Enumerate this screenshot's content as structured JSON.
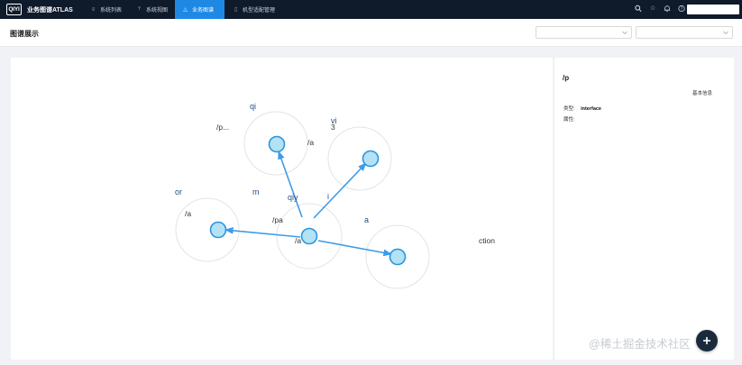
{
  "app": {
    "logo_text": "QIYI",
    "title": "业务图谱ATLAS"
  },
  "nav": [
    {
      "label": "系统列表",
      "icon": "list-icon",
      "active": false
    },
    {
      "label": "系统视图",
      "icon": "share-icon",
      "active": false
    },
    {
      "label": "业务图谱",
      "icon": "graph-icon",
      "active": true
    },
    {
      "label": "机型适配管理",
      "icon": "mobile-icon",
      "active": false
    }
  ],
  "topbar_icons": [
    "search-icon",
    "star-icon",
    "bell-icon",
    "help-icon"
  ],
  "page": {
    "title": "图谱展示"
  },
  "graph": {
    "labels": [
      {
        "text": "qi",
        "dark": false
      },
      {
        "text": "/p...",
        "dark": true
      },
      {
        "text": "3",
        "dark": true
      },
      {
        "text": "vi",
        "dark": false
      },
      {
        "text": "/a",
        "dark": true
      },
      {
        "text": "or",
        "dark": false
      },
      {
        "text": "m",
        "dark": false
      },
      {
        "text": "/a",
        "dark": true
      },
      {
        "text": "qiy",
        "dark": false
      },
      {
        "text": "i",
        "dark": false
      },
      {
        "text": "/pa",
        "dark": true
      },
      {
        "text": "a",
        "dark": false
      },
      {
        "text": "/a",
        "dark": true
      },
      {
        "text": "ction",
        "dark": true
      }
    ],
    "colors": {
      "node_fill": "#b3e2f5",
      "node_stroke": "#2b95e0",
      "edge": "#3d9be9",
      "halo": "#e4e4e4"
    }
  },
  "side": {
    "title": "/p",
    "tab": "基本信息",
    "type_label": "类型:",
    "type_value": "interface",
    "props_label": "属性:"
  },
  "watermark": "@稀土掘金技术社区"
}
